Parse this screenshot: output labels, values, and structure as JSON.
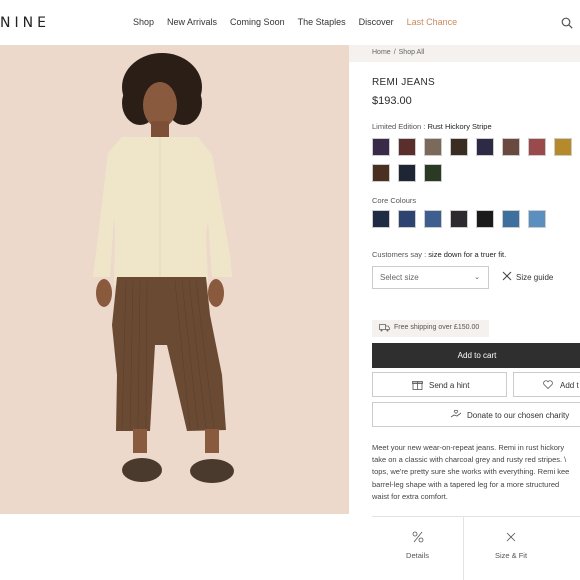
{
  "brand": {
    "logo": "NINE"
  },
  "nav": {
    "items": [
      "Shop",
      "New Arrivals",
      "Coming Soon",
      "The Staples",
      "Discover",
      "Last Chance"
    ],
    "search_icon": "search-icon"
  },
  "breadcrumb": {
    "home": "Home",
    "separator": "/",
    "current": "Shop All"
  },
  "product": {
    "title": "REMI JEANS",
    "price": "$193.00",
    "limited_label": "Limited Edition :",
    "limited_value": "Rust Hickory Stripe",
    "core_label": "Core Colours",
    "customers_label": "Customers say :",
    "customers_value": "size down for a truer fit.",
    "size_placeholder": "Select size",
    "size_guide": "Size guide",
    "shipping": "Free shipping over £150.00",
    "add_to_cart": "Add to cart",
    "send_hint": "Send a hint",
    "add_partial": "Add t",
    "donate": "Donate to our chosen charity",
    "description": [
      "Meet your new wear-on-repeat jeans. Remi in rust hickory",
      "take on a classic with charcoal grey and rusty red stripes. \\",
      "tops, we're pretty sure she works with everything. Remi kee",
      "barrel-leg shape with a tapered leg for a more structured",
      "waist for extra comfort."
    ],
    "tabs": [
      "Details",
      "Size & Fit"
    ]
  },
  "swatches": {
    "limited_colors": [
      "#3a2a4a",
      "#5a2e2a",
      "#7b6a5a",
      "#3b2c22",
      "#2c2a45",
      "#6a4a3e",
      "#9a4a4a",
      "#b58a2a",
      "#c0553a",
      "#4a3020",
      "#1e2535",
      "#2a3a25"
    ],
    "core_colors": [
      "#1f2a44",
      "#2d4470",
      "#3e5e8f",
      "#2c2a2e",
      "#1b1b1b",
      "#3d6f9f",
      "#5b8fc0"
    ]
  },
  "colors": {
    "accent": "#c98a5e",
    "cart_bg": "#2f2f2f",
    "hero_bg": "#ecd9cc"
  }
}
